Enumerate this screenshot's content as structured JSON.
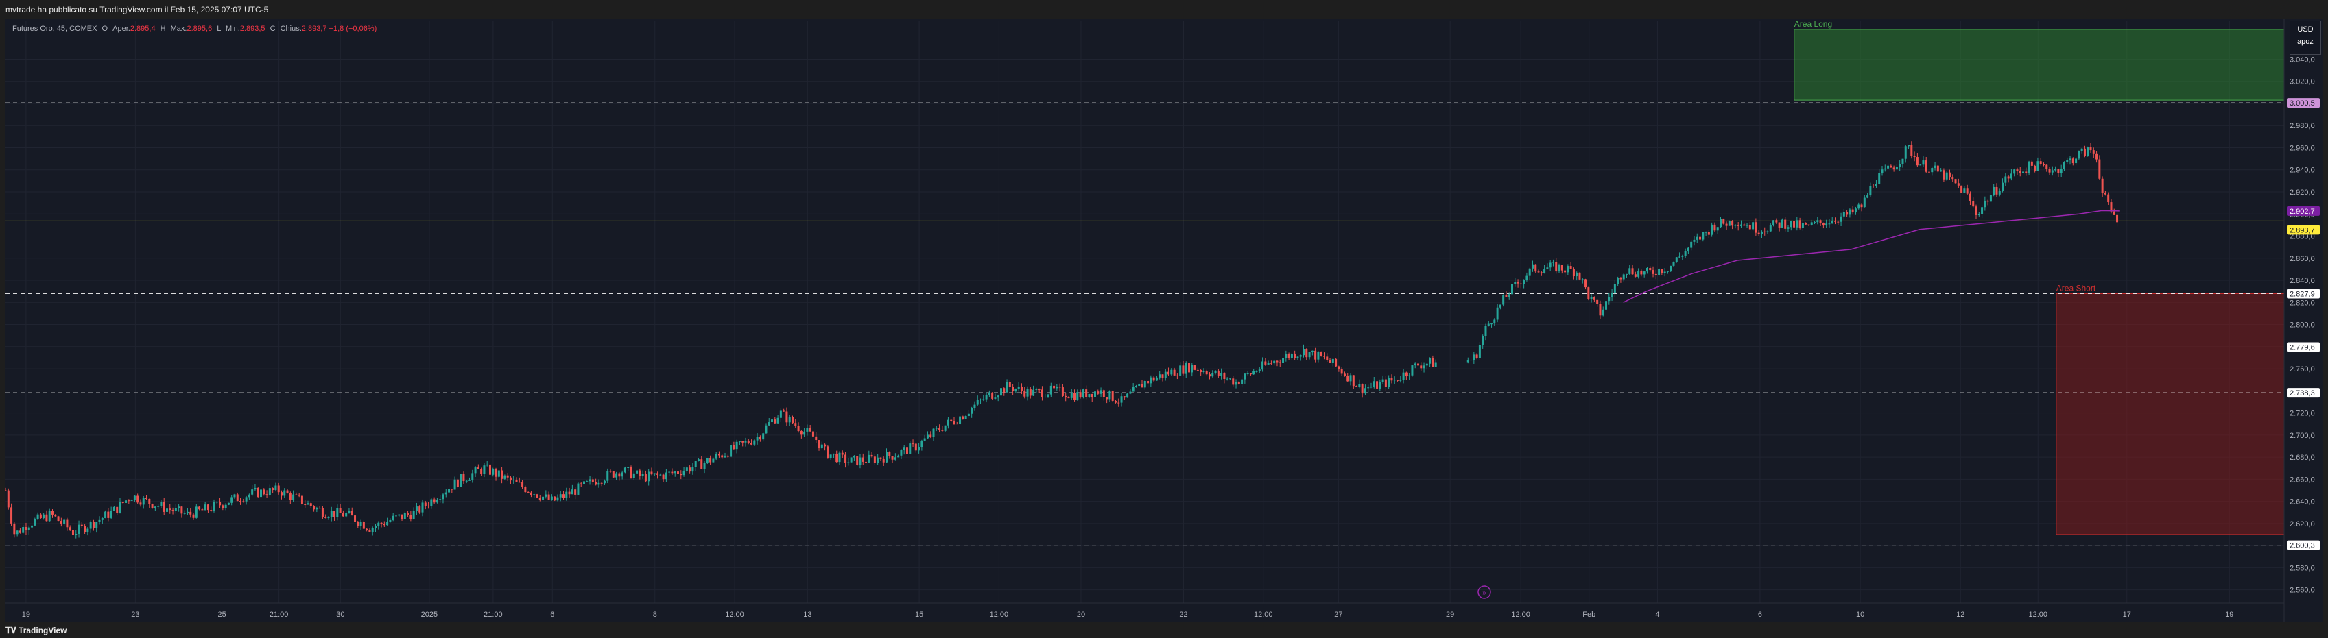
{
  "header": {
    "text": "mvtrade ha pubblicato su TradingView.com il Feb 15, 2025 07:07 UTC-5"
  },
  "legend": {
    "symbol": "Futures Oro, 45, COMEX",
    "open_label": "O",
    "open_prefix": "Aper.",
    "open": "2.895,4",
    "high_label": "H",
    "high_prefix": "Max.",
    "high": "2.895,6",
    "low_label": "L",
    "low_prefix": "Min.",
    "low": "2.893,5",
    "close_label": "C",
    "close_prefix": "Chius.",
    "close": "2.893,7",
    "change": "−1,8 (−0,06%)"
  },
  "currency": {
    "code": "USD",
    "unit": "apoz"
  },
  "footer": {
    "brand": "TradingView"
  },
  "colors": {
    "up": "#26a69a",
    "down": "#ef5350",
    "ma": "#9c27b0",
    "area_long": "#1b5e20",
    "area_short": "#7f0000"
  },
  "chart_data": {
    "type": "candlestick",
    "y_ticks": [
      "2.560,0",
      "2.580,0",
      "2.600,0",
      "2.620,0",
      "2.640,0",
      "2.660,0",
      "2.680,0",
      "2.700,0",
      "2.720,0",
      "2.740,0",
      "2.760,0",
      "2.780,0",
      "2.800,0",
      "2.820,0",
      "2.840,0",
      "2.860,0",
      "2.880,0",
      "2.900,0",
      "2.920,0",
      "2.940,0",
      "2.960,0",
      "2.980,0",
      "3.000,0",
      "3.020,0",
      "3.040,0"
    ],
    "y_tick_values": [
      2560,
      2580,
      2600,
      2620,
      2640,
      2660,
      2680,
      2700,
      2720,
      2740,
      2760,
      2780,
      2800,
      2820,
      2840,
      2860,
      2880,
      2900,
      2920,
      2940,
      2960,
      2980,
      3000,
      3020,
      3040
    ],
    "ylim": [
      2548,
      3075
    ],
    "x_ticks": [
      "19",
      "23",
      "25",
      "21:00",
      "30",
      "2025",
      "21:00",
      "6",
      "8",
      "12:00",
      "13",
      "15",
      "12:00",
      "20",
      "22",
      "12:00",
      "27",
      "29",
      "12:00",
      "Feb",
      "4",
      "6",
      "10",
      "12",
      "12:00",
      "17",
      "19"
    ],
    "x_tick_positions": [
      0.009,
      0.057,
      0.095,
      0.12,
      0.147,
      0.186,
      0.214,
      0.24,
      0.285,
      0.32,
      0.352,
      0.401,
      0.436,
      0.472,
      0.517,
      0.552,
      0.585,
      0.634,
      0.665,
      0.695,
      0.725,
      0.77,
      0.814,
      0.858,
      0.892,
      0.931,
      0.976
    ],
    "horizontal_levels": [
      {
        "value": 3000.5,
        "label": "3.000,5",
        "color": "#ffffff"
      },
      {
        "value": 2827.9,
        "label": "2.827,9",
        "color": "#ffffff"
      },
      {
        "value": 2779.6,
        "label": "2.779,6",
        "color": "#ffffff"
      },
      {
        "value": 2738.3,
        "label": "2.738,3",
        "color": "#ffffff"
      },
      {
        "value": 2600.3,
        "label": "2.600,3",
        "color": "#ffffff"
      }
    ],
    "price_line": {
      "value": 2893.7,
      "label": "2.893,7",
      "color": "#ffeb3b"
    },
    "ma_last": {
      "value": 2902.7,
      "label": "2.902,7",
      "color": "#9c27b0"
    },
    "zones": [
      {
        "name": "Area Long",
        "label": "Area Long",
        "color": "#2e7d32",
        "label_color": "#4caf50",
        "top": 3067,
        "bottom": 3003,
        "x_start": 0.785,
        "x_end": 1.0
      },
      {
        "name": "Area Short",
        "label": "Area Short",
        "color": "#7f1d1d",
        "label_color": "#d32f2f",
        "top": 2828,
        "bottom": 2610,
        "x_start": 0.9,
        "x_end": 1.0
      }
    ],
    "path": [
      [
        0.0,
        2650
      ],
      [
        0.004,
        2610
      ],
      [
        0.01,
        2620
      ],
      [
        0.02,
        2628
      ],
      [
        0.03,
        2612
      ],
      [
        0.04,
        2622
      ],
      [
        0.048,
        2632
      ],
      [
        0.055,
        2645
      ],
      [
        0.062,
        2640
      ],
      [
        0.07,
        2634
      ],
      [
        0.08,
        2628
      ],
      [
        0.09,
        2634
      ],
      [
        0.1,
        2642
      ],
      [
        0.11,
        2648
      ],
      [
        0.12,
        2650
      ],
      [
        0.13,
        2640
      ],
      [
        0.14,
        2630
      ],
      [
        0.15,
        2628
      ],
      [
        0.16,
        2616
      ],
      [
        0.17,
        2624
      ],
      [
        0.18,
        2630
      ],
      [
        0.19,
        2646
      ],
      [
        0.2,
        2660
      ],
      [
        0.21,
        2670
      ],
      [
        0.22,
        2660
      ],
      [
        0.23,
        2650
      ],
      [
        0.24,
        2640
      ],
      [
        0.25,
        2650
      ],
      [
        0.26,
        2660
      ],
      [
        0.27,
        2668
      ],
      [
        0.28,
        2662
      ],
      [
        0.29,
        2664
      ],
      [
        0.3,
        2670
      ],
      [
        0.31,
        2678
      ],
      [
        0.32,
        2688
      ],
      [
        0.33,
        2698
      ],
      [
        0.335,
        2710
      ],
      [
        0.34,
        2720
      ],
      [
        0.345,
        2712
      ],
      [
        0.35,
        2704
      ],
      [
        0.355,
        2698
      ],
      [
        0.36,
        2684
      ],
      [
        0.37,
        2676
      ],
      [
        0.38,
        2678
      ],
      [
        0.39,
        2682
      ],
      [
        0.4,
        2690
      ],
      [
        0.41,
        2706
      ],
      [
        0.42,
        2718
      ],
      [
        0.43,
        2734
      ],
      [
        0.44,
        2744
      ],
      [
        0.45,
        2738
      ],
      [
        0.46,
        2740
      ],
      [
        0.47,
        2736
      ],
      [
        0.48,
        2740
      ],
      [
        0.49,
        2730
      ],
      [
        0.5,
        2748
      ],
      [
        0.51,
        2756
      ],
      [
        0.52,
        2762
      ],
      [
        0.53,
        2756
      ],
      [
        0.54,
        2748
      ],
      [
        0.55,
        2760
      ],
      [
        0.56,
        2770
      ],
      [
        0.57,
        2776
      ],
      [
        0.58,
        2768
      ],
      [
        0.59,
        2752
      ],
      [
        0.595,
        2742
      ],
      [
        0.6,
        2744
      ],
      [
        0.61,
        2750
      ],
      [
        0.62,
        2764
      ],
      [
        0.63,
        2766
      ],
      [
        0.64,
        2766
      ],
      [
        0.645,
        2770
      ],
      [
        0.65,
        2798
      ],
      [
        0.66,
        2830
      ],
      [
        0.67,
        2850
      ],
      [
        0.68,
        2852
      ],
      [
        0.69,
        2848
      ],
      [
        0.695,
        2825
      ],
      [
        0.7,
        2810
      ],
      [
        0.705,
        2830
      ],
      [
        0.71,
        2850
      ],
      [
        0.72,
        2846
      ],
      [
        0.73,
        2852
      ],
      [
        0.74,
        2872
      ],
      [
        0.75,
        2890
      ],
      [
        0.76,
        2894
      ],
      [
        0.77,
        2886
      ],
      [
        0.78,
        2892
      ],
      [
        0.79,
        2888
      ],
      [
        0.8,
        2894
      ],
      [
        0.81,
        2900
      ],
      [
        0.815,
        2908
      ],
      [
        0.82,
        2930
      ],
      [
        0.83,
        2946
      ],
      [
        0.835,
        2960
      ],
      [
        0.84,
        2946
      ],
      [
        0.85,
        2936
      ],
      [
        0.86,
        2920
      ],
      [
        0.865,
        2900
      ],
      [
        0.87,
        2914
      ],
      [
        0.88,
        2936
      ],
      [
        0.89,
        2944
      ],
      [
        0.9,
        2940
      ],
      [
        0.91,
        2954
      ],
      [
        0.915,
        2958
      ],
      [
        0.918,
        2952
      ],
      [
        0.92,
        2920
      ],
      [
        0.924,
        2902
      ],
      [
        0.928,
        2893.7
      ]
    ],
    "ma_path": [
      [
        0.71,
        2820
      ],
      [
        0.72,
        2830
      ],
      [
        0.73,
        2838
      ],
      [
        0.74,
        2846
      ],
      [
        0.75,
        2852
      ],
      [
        0.76,
        2858
      ],
      [
        0.77,
        2860
      ],
      [
        0.78,
        2862
      ],
      [
        0.79,
        2864
      ],
      [
        0.8,
        2866
      ],
      [
        0.81,
        2868
      ],
      [
        0.82,
        2874
      ],
      [
        0.83,
        2880
      ],
      [
        0.84,
        2886
      ],
      [
        0.85,
        2888
      ],
      [
        0.86,
        2890
      ],
      [
        0.87,
        2892
      ],
      [
        0.88,
        2894
      ],
      [
        0.89,
        2896
      ],
      [
        0.9,
        2898
      ],
      [
        0.91,
        2900
      ],
      [
        0.92,
        2903
      ],
      [
        0.928,
        2902.7
      ]
    ]
  }
}
